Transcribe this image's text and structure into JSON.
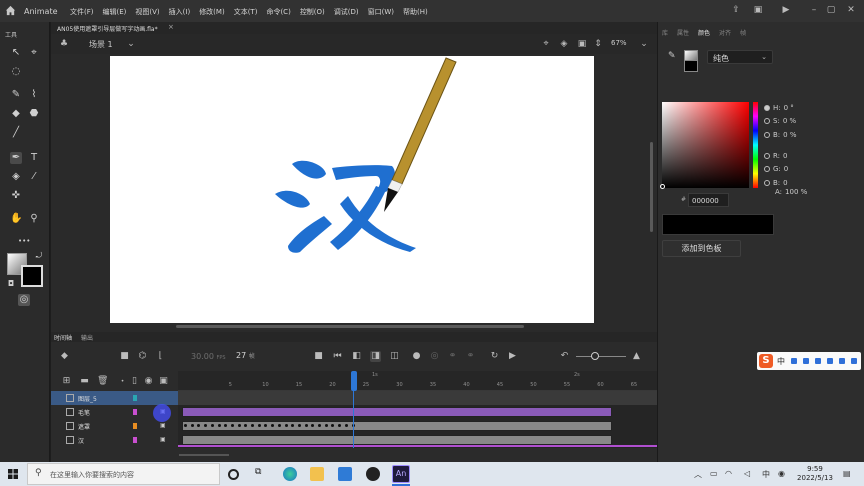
{
  "app": {
    "name": "Animate",
    "menus": [
      "文件(F)",
      "编辑(E)",
      "视图(V)",
      "插入(I)",
      "修改(M)",
      "文本(T)",
      "命令(C)",
      "控制(O)",
      "调试(D)",
      "窗口(W)",
      "帮助(H)"
    ]
  },
  "document": {
    "tab_title": "AN05使用遮罩引导层做写字动画.fla*",
    "close_glyph": "×"
  },
  "toolbar": {
    "label": "工具",
    "more_glyph": "•••"
  },
  "editbar": {
    "scene": "场景 1",
    "zoom": "67%"
  },
  "stage": {
    "character": "汉",
    "ink_color": "#1f6fd0",
    "brush_handle_color": "#b8912e",
    "background": "#ffffff"
  },
  "color_panel": {
    "tabs": [
      "库",
      "属性",
      "颜色",
      "对齐",
      "帧"
    ],
    "active_tab": "颜色",
    "type": "纯色",
    "hsb": [
      {
        "label": "H:",
        "value": "0 °",
        "selected": true
      },
      {
        "label": "S:",
        "value": "0 %",
        "selected": false
      },
      {
        "label": "B:",
        "value": "0 %",
        "selected": false
      }
    ],
    "rgb": [
      {
        "label": "R:",
        "value": "0"
      },
      {
        "label": "G:",
        "value": "0"
      },
      {
        "label": "B:",
        "value": "0"
      }
    ],
    "alpha": {
      "label": "A:",
      "value": "100 %"
    },
    "hex_prefix": "#",
    "hex": "000000",
    "add_swatch": "添加到色板",
    "swatch_color": "#000000"
  },
  "ime": {
    "logo": "S",
    "mode": "中"
  },
  "timeline": {
    "tabs": [
      "时间轴",
      "输出"
    ],
    "fps": "30.00",
    "fps_unit": "FPS",
    "current_frame": "27",
    "frame_unit": "帧",
    "ruler_seconds": [
      "1s",
      "2s"
    ],
    "ruler_ticks": [
      "5",
      "10",
      "15",
      "20",
      "25",
      "30",
      "35",
      "40",
      "45",
      "50",
      "55",
      "60",
      "65"
    ],
    "layers": [
      {
        "name": "图层_5",
        "color": "#2aa7b3",
        "selected": true
      },
      {
        "name": "毛笔",
        "color": "#c94fd0",
        "selected": false
      },
      {
        "name": "遮罩",
        "color": "#e88d22",
        "selected": false
      },
      {
        "name": "汉",
        "color": "#c94fd0",
        "selected": false
      }
    ]
  },
  "taskbar": {
    "search_placeholder": "在这里输入你要搜索的内容",
    "time": "9:59",
    "date": "2022/5/13",
    "lang": "中"
  }
}
